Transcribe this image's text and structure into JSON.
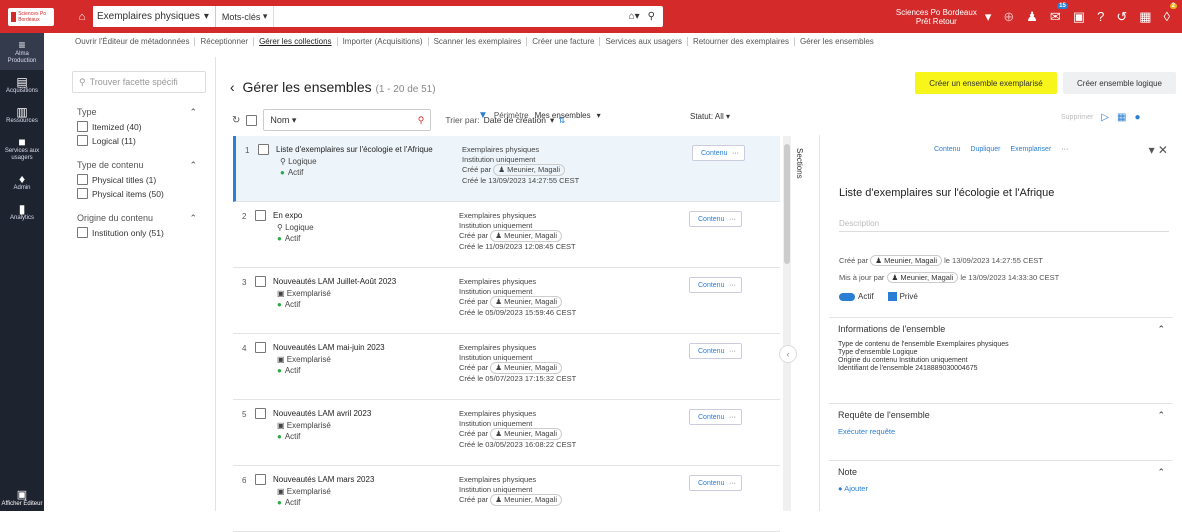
{
  "topbar": {
    "logo": "Sciences Po Bordeaux",
    "scope": "Exemplaires physiques",
    "keywords": "Mots-clés",
    "institution_line1": "Sciences Po Bordeaux",
    "institution_line2": "Prêt Retour",
    "badges": {
      "tasks": "15",
      "alert": "2"
    }
  },
  "sidebar": {
    "items": [
      {
        "icon": "≡",
        "label": "Alma Production"
      },
      {
        "icon": "▤",
        "label": "Acquisitions"
      },
      {
        "icon": "▥",
        "label": "Ressources"
      },
      {
        "icon": "■",
        "label": "Services aux usagers"
      },
      {
        "icon": "♦",
        "label": "Admin"
      },
      {
        "icon": "▮",
        "label": "Analytics"
      }
    ],
    "bottom": "Afficher Éditeur"
  },
  "nav": [
    "Ouvrir l'Éditeur de métadonnées",
    "Réceptionner",
    "Gérer les collections",
    "Importer (Acquisitions)",
    "Scanner les exemplaires",
    "Créer une facture",
    "Services aux usagers",
    "Retourner des exemplaires",
    "Gérer les ensembles"
  ],
  "facets": {
    "search_placeholder": "Trouver facette spécifi",
    "groups": [
      {
        "title": "Type",
        "options": [
          "Itemized (40)",
          "Logical (11)"
        ]
      },
      {
        "title": "Type de contenu",
        "options": [
          "Physical titles (1)",
          "Physical items (50)"
        ]
      },
      {
        "title": "Origine du contenu",
        "options": [
          "Institution only (51)"
        ]
      }
    ]
  },
  "main": {
    "title": "Gérer les ensembles",
    "count": "(1 - 20 de 51)",
    "create_item_set": "Créer un ensemble exemplarisé",
    "create_logical_set": "Créer ensemble logique",
    "name_field": "Nom",
    "sort_label": "Trier par:",
    "sort_value": "Date de création",
    "filter1": "Périmètre",
    "filter1_value": "Mes ensembles",
    "status": "Statut:",
    "status_value": "All",
    "delete": "Supprimer"
  },
  "rows": [
    {
      "n": "1",
      "name": "Liste d'exemplaires sur l'écologie et l'Afrique",
      "type": "Logique",
      "status": "Actif",
      "content": "Exemplaires physiques",
      "origin": "Institution uniquement",
      "creator": "Meunier, Magali",
      "created": "Créé le 13/09/2023 14:27:55 CEST"
    },
    {
      "n": "2",
      "name": "En expo",
      "type": "Logique",
      "status": "Actif",
      "content": "Exemplaires physiques",
      "origin": "Institution uniquement",
      "creator": "Meunier, Magali",
      "created": "Créé le 11/09/2023 12:08:45 CEST"
    },
    {
      "n": "3",
      "name": "Nouveautés LAM Juillet-Août 2023",
      "type": "Exemplarisé",
      "status": "Actif",
      "content": "Exemplaires physiques",
      "origin": "Institution uniquement",
      "creator": "Meunier, Magali",
      "created": "Créé le 05/09/2023 15:59:46 CEST"
    },
    {
      "n": "4",
      "name": "Nouveautés LAM mai-juin 2023",
      "type": "Exemplarisé",
      "status": "Actif",
      "content": "Exemplaires physiques",
      "origin": "Institution uniquement",
      "creator": "Meunier, Magali",
      "created": "Créé le 05/07/2023 17:15:32 CEST"
    },
    {
      "n": "5",
      "name": "Nouveautés LAM avril 2023",
      "type": "Exemplarisé",
      "status": "Actif",
      "content": "Exemplaires physiques",
      "origin": "Institution uniquement",
      "creator": "Meunier, Magali",
      "created": "Créé le 03/05/2023 16:08:22 CEST"
    },
    {
      "n": "6",
      "name": "Nouveautés LAM mars 2023",
      "type": "Exemplarisé",
      "status": "Actif",
      "content": "Exemplaires physiques",
      "origin": "Institution uniquement",
      "creator": "Meunier, Magali",
      "created": ""
    }
  ],
  "row_labels": {
    "contents": "Contenu",
    "created_by": "Créé par"
  },
  "sections_label": "Sections",
  "detail": {
    "tools": [
      "Contenu",
      "Dupliquer",
      "Exemplariser"
    ],
    "title": "Liste d'exemplaires sur l'écologie et l'Afrique",
    "desc_placeholder": "Description",
    "created_by": "Créé par",
    "creator": "Meunier, Magali",
    "created_at": "le 13/09/2023 14:27:55 CEST",
    "updated_by": "Mis à jour par",
    "updater": "Meunier, Magali",
    "updated_at": "le 13/09/2023 14:33:30 CEST",
    "active": "Actif",
    "private": "Privé",
    "info_title": "Informations de l'ensemble",
    "info_lines": [
      "Type de contenu de l'ensemble Exemplaires physiques",
      "Type d'ensemble Logique",
      "Origine du contenu Institution uniquement",
      "Identifiant de l'ensemble 2418889030004675"
    ],
    "query_title": "Requête de l'ensemble",
    "query_link": "Exécuter requête",
    "note_title": "Note",
    "note_add": "Ajouter"
  }
}
